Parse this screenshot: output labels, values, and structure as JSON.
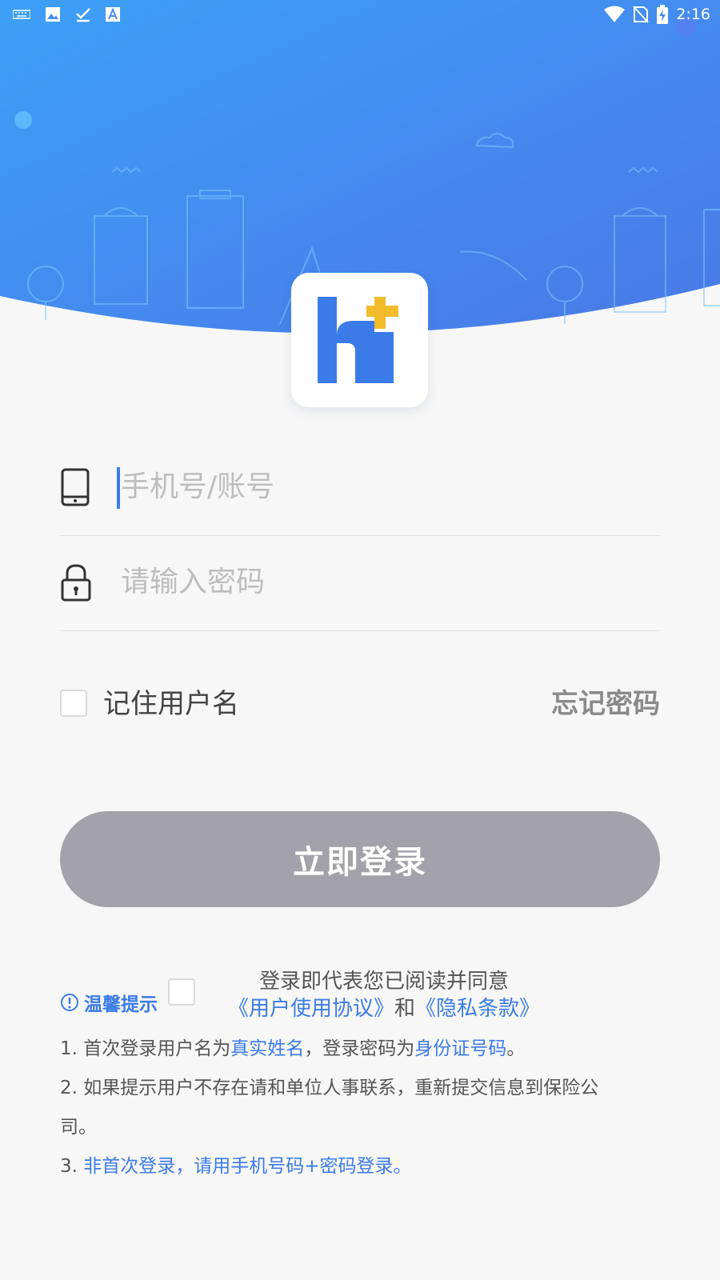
{
  "status_bar": {
    "time": "2:16",
    "left_icons": [
      "keyboard-icon",
      "image-icon",
      "check-icon",
      "font-icon"
    ],
    "right_icons": [
      "wifi-icon",
      "no-sim-icon",
      "battery-charging-icon"
    ]
  },
  "colors": {
    "brand": "#3b7be8",
    "accent_yellow": "#f2bb2a",
    "hero_top": "#3d98f5",
    "button": "#a3a2aa"
  },
  "form": {
    "phone_placeholder": "手机号/账号",
    "password_placeholder": "请输入密码",
    "remember_label": "记住用户名",
    "forgot_label": "忘记密码",
    "login_label": "立即登录"
  },
  "agreement": {
    "line1": "登录即代表您已阅读并同意",
    "user_agreement": "《用户使用协议》",
    "and": "和",
    "privacy": "《隐私条款》"
  },
  "tips": {
    "title": "温馨提示",
    "t1_prefix": "1. 首次登录用户名为",
    "t1_name": "真实姓名",
    "t1_mid": "，登录密码为",
    "t1_id": "身份证号码",
    "t1_end": "。",
    "t2_line1": "2. 如果提示用户不存在请和单位人事联系，重新提交信息到保险公",
    "t2_line2": "司。",
    "t3_prefix": "3. ",
    "t3_text": "非首次登录，请用手机号码+密码登录。"
  }
}
